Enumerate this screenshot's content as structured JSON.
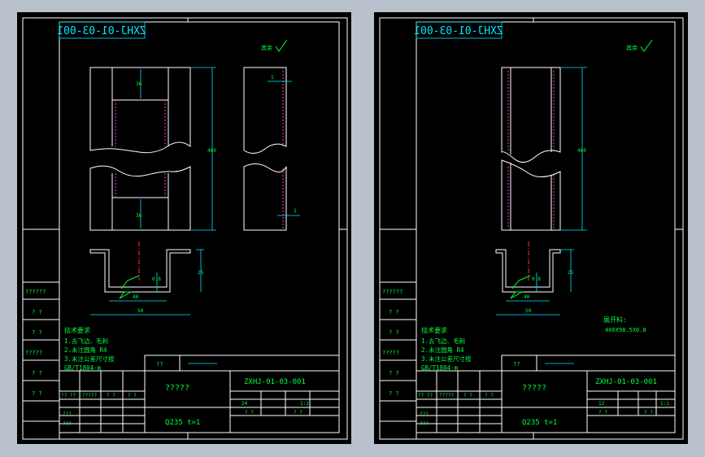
{
  "left_sheet": {
    "mirrored_code": "ZXHJ-01-03-001",
    "roughness": "其余",
    "dim_top_width": "36",
    "dim_bottom_width": "36",
    "dim_length": "460",
    "dim_side_top": "1",
    "dim_side_bottom": "1",
    "dim_section_height": "25",
    "dim_section_h2": "0.8",
    "dim_section_inner": "40",
    "dim_section_width": "50",
    "tech_title": "技术要求",
    "tech_lines": [
      "1.去飞边、毛刺",
      "2.未注圆角 R4",
      "3.未注公差尺寸按",
      "GB/T1804-m"
    ],
    "rev_labels": [
      "??????",
      "? ?",
      "? ?",
      "?????",
      "? ?",
      "? ?",
      "???",
      "???"
    ],
    "rev_table_row": [
      "?? ??",
      "?????",
      "? ?",
      "? ?"
    ],
    "title_label": "??",
    "part_name": "?????",
    "drawing_no": "ZXHJ-01-03-001",
    "qty": "24",
    "scale": "1:1",
    "material": "Q235  t=1",
    "page_a": "? ?",
    "page_b": "? ?"
  },
  "right_sheet": {
    "mirrored_code": "ZXHJ-01-03-001",
    "roughness": "其余",
    "dim_length": "460",
    "dim_section_height": "25",
    "dim_section_h2": "0.8",
    "dim_section_inner": "40",
    "dim_section_width": "50",
    "blank_label": "展开料:",
    "blank_size": "460X98.5X0.8",
    "tech_title": "技术要求",
    "tech_lines": [
      "1.去飞边、毛刺",
      "2.未注圆角 R4",
      "3.未注公差尺寸按",
      "GB/T1804-m"
    ],
    "rev_labels": [
      "??????",
      "? ?",
      "? ?",
      "?????",
      "? ?",
      "? ?",
      "???",
      "???"
    ],
    "rev_table_row": [
      "?? ??",
      "?????",
      "? ?",
      "? ?"
    ],
    "title_label": "??",
    "part_name": "?????",
    "drawing_no": "ZXHJ-01-03-001",
    "qty": "12",
    "scale": "1:1",
    "material": "Q235  t=1",
    "page_a": "? ?",
    "page_b": "? ?"
  }
}
